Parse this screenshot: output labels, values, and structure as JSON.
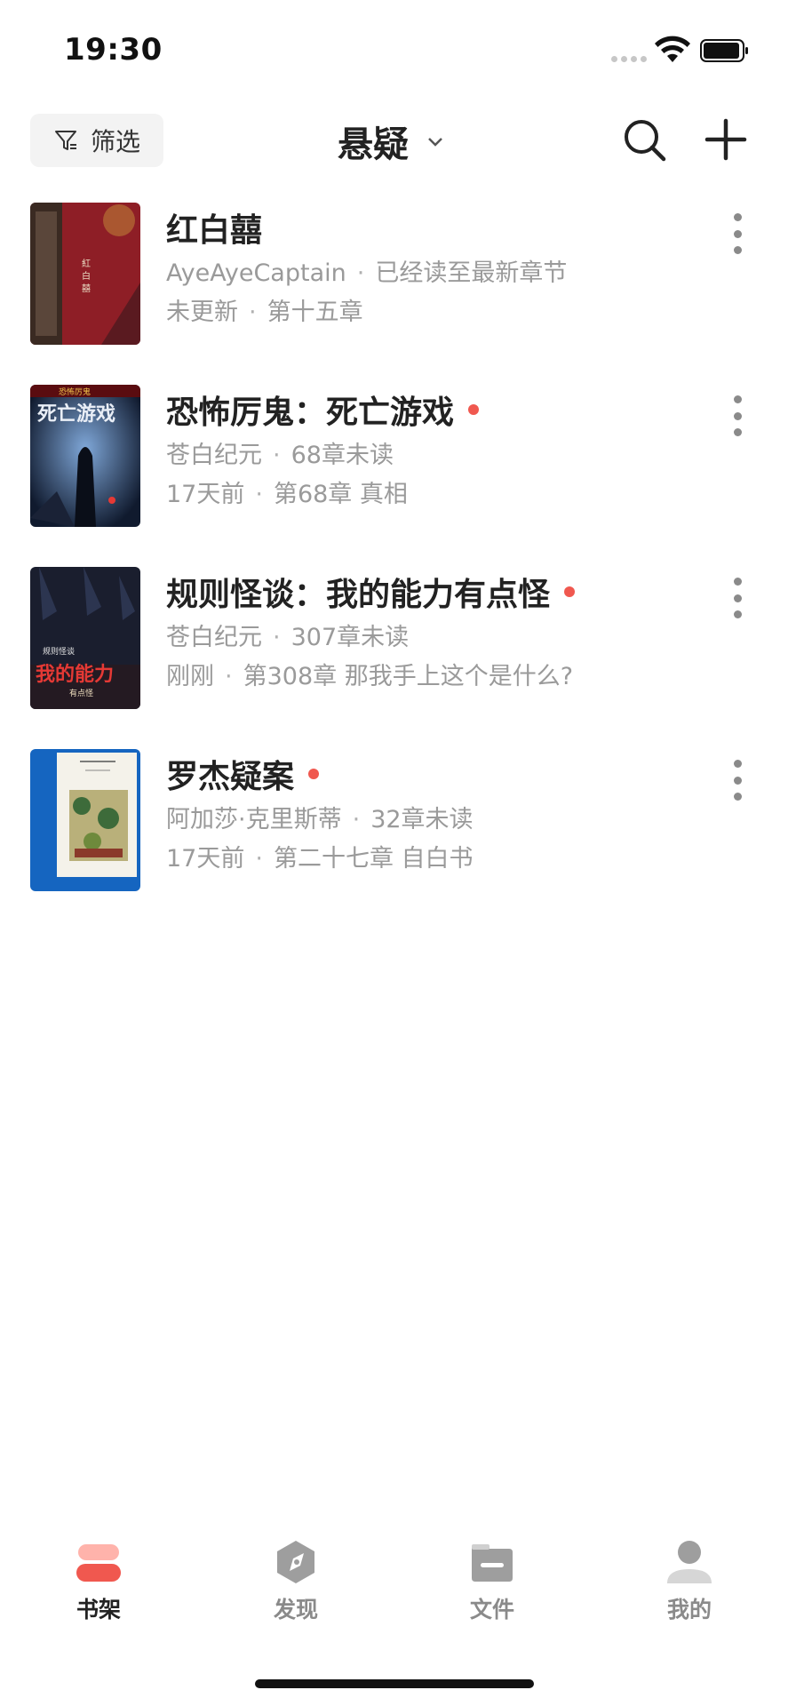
{
  "status_bar": {
    "time": "19:30"
  },
  "header": {
    "filter_label": "筛选",
    "title": "悬疑"
  },
  "books": [
    {
      "title": "红白囍",
      "author": "AyeAyeCaptain",
      "status": "已经读至最新章节",
      "updated": "未更新",
      "chapter": "第十五章",
      "has_update": false,
      "cover_color": "#8e1e26"
    },
    {
      "title": "恐怖厉鬼：死亡游戏",
      "author": "苍白纪元",
      "status": "68章未读",
      "updated": "17天前",
      "chapter": "第68章 真相",
      "has_update": true,
      "cover_color": "#1c2a44"
    },
    {
      "title": "规则怪谈：我的能力有点怪",
      "author": "苍白纪元",
      "status": "307章未读",
      "updated": "刚刚",
      "chapter": "第308章 那我手上这个是什么?",
      "has_update": true,
      "cover_color": "#1a1e2e"
    },
    {
      "title": "罗杰疑案",
      "author": "阿加莎·克里斯蒂",
      "status": "32章未读",
      "updated": "17天前",
      "chapter": "第二十七章 自白书",
      "has_update": true,
      "cover_color": "#1565c0"
    }
  ],
  "tabs": [
    {
      "label": "书架",
      "icon": "bookshelf-icon",
      "active": true
    },
    {
      "label": "发现",
      "icon": "compass-icon",
      "active": false
    },
    {
      "label": "文件",
      "icon": "folder-icon",
      "active": false
    },
    {
      "label": "我的",
      "icon": "user-icon",
      "active": false
    }
  ],
  "colors": {
    "accent": "#f0584f",
    "text_primary": "#222222",
    "text_secondary": "#9a9a9a"
  }
}
